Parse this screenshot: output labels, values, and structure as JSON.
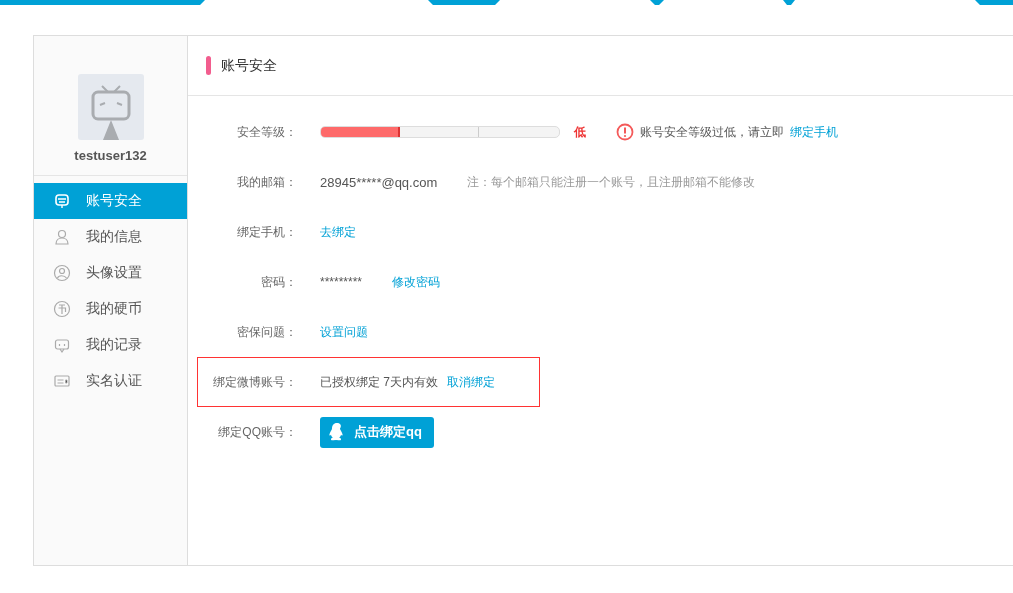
{
  "sidebar": {
    "username": "testuser132",
    "items": [
      {
        "label": "账号安全",
        "selected": true
      },
      {
        "label": "我的信息",
        "selected": false
      },
      {
        "label": "头像设置",
        "selected": false
      },
      {
        "label": "我的硬币",
        "selected": false
      },
      {
        "label": "我的记录",
        "selected": false
      },
      {
        "label": "实名认证",
        "selected": false
      }
    ]
  },
  "content": {
    "title": "账号安全",
    "rows": [
      {
        "kind": "level",
        "label": "安全等级：",
        "level": 0.33,
        "rating": "低",
        "warning": "账号安全等级过低，请立即",
        "warning_link": "绑定手机",
        "highlighted": false
      },
      {
        "kind": "text",
        "label": "我的邮箱：",
        "value": "28945*****@qq.com",
        "note": "注：每个邮箱只能注册一个账号，且注册邮箱不能修改",
        "highlighted": false
      },
      {
        "kind": "link",
        "label": "绑定手机：",
        "link": "去绑定",
        "highlighted": false
      },
      {
        "kind": "text",
        "label": "密码：",
        "value": "*********",
        "link": "修改密码",
        "highlighted": false
      },
      {
        "kind": "link",
        "label": "密保问题：",
        "link": "设置问题",
        "highlighted": false
      },
      {
        "kind": "text",
        "label": "绑定微博账号：",
        "value": "已授权绑定 7天内有效",
        "link": "取消绑定",
        "highlighted": true
      },
      {
        "kind": "button",
        "label": "绑定QQ账号：",
        "button": "点击绑定qq",
        "highlighted": false
      }
    ]
  }
}
